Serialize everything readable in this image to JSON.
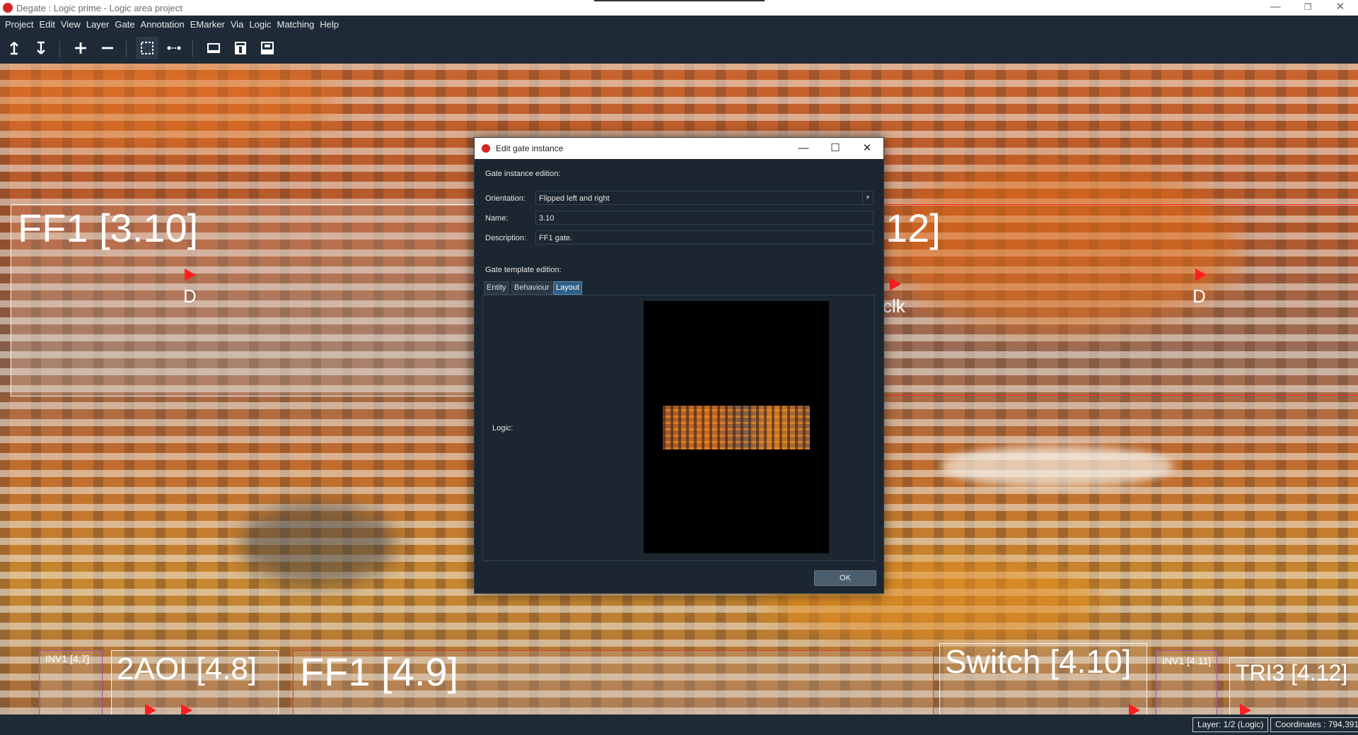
{
  "window": {
    "title": "Degate : Logic prime - Logic area project",
    "controls": {
      "minimize": "—",
      "restore": "❐",
      "close": "✕"
    }
  },
  "menu": [
    "Project",
    "Edit",
    "View",
    "Layer",
    "Gate",
    "Annotation",
    "EMarker",
    "Via",
    "Logic",
    "Matching",
    "Help"
  ],
  "toolbar": {
    "tools": [
      "layer-up-icon",
      "layer-down-icon",
      "zoom-in-icon",
      "zoom-out-icon",
      "area-select-icon",
      "wire-tool-icon",
      "gate-library-icon",
      "gate-template-icon",
      "gate-instance-icon"
    ],
    "active_tool": "area-select-icon"
  },
  "canvas": {
    "gates_top": [
      {
        "label": "FF1 [3.10]"
      },
      {
        "label": "12]"
      }
    ],
    "port_labels": [
      "D",
      "clk",
      "D"
    ],
    "gates_bottom": [
      {
        "label": "INV1 [4.7]"
      },
      {
        "label": "2AOI [4.8]"
      },
      {
        "label": "FF1 [4.9]"
      },
      {
        "label": "Switch [4.10]"
      },
      {
        "label": "INV1 [4.11]"
      },
      {
        "label": "TRI3 [4.12]"
      }
    ]
  },
  "status": {
    "layer": "Layer: 1/2 (Logic)",
    "coordinates": "Coordinates : 794,391"
  },
  "dialog": {
    "title": "Edit gate instance",
    "instance_section": "Gate instance edition:",
    "orientation_label": "Orientation:",
    "orientation_value": "Flipped left and right",
    "name_label": "Name:",
    "name_value": "3.10",
    "description_label": "Description:",
    "description_value": "FF1 gate.",
    "template_section": "Gate template edition:",
    "tabs": [
      "Entity",
      "Behaviour",
      "Layout"
    ],
    "selected_tab": "Layout",
    "logic_label": "Logic:",
    "ok_label": "OK",
    "controls": {
      "minimize": "—",
      "maximize": "☐",
      "close": "✕"
    }
  },
  "colors": {
    "ui_background": "#1b2630",
    "port_marker": "#ff1f1f",
    "selected_tab": "#2f5e86",
    "app_icon": "#d22727"
  }
}
